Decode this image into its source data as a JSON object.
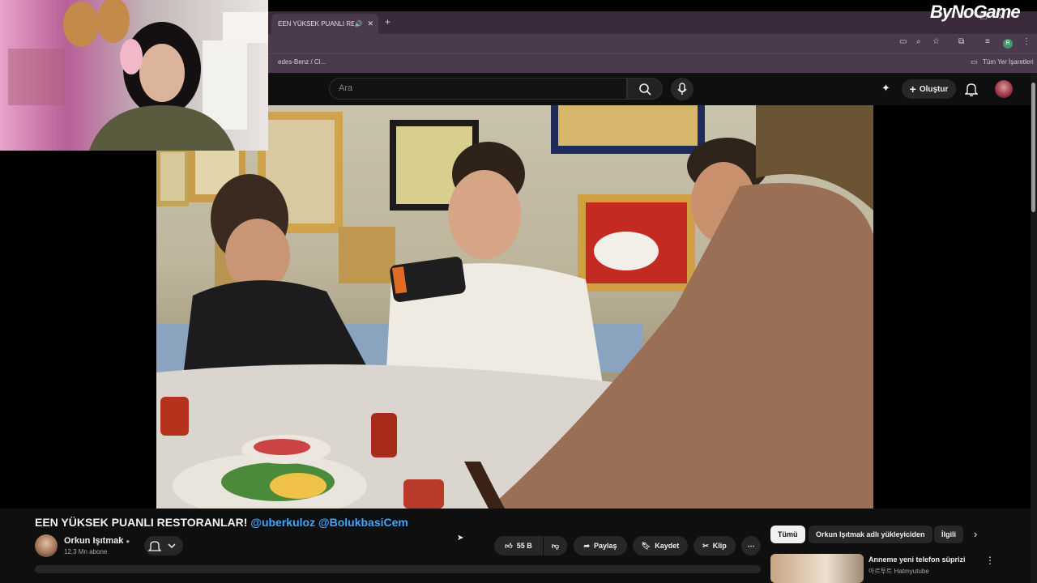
{
  "brand": {
    "logo_text": "ByNoGame"
  },
  "browser": {
    "tab_title": "EEN YÜKSEK PUANLI RESTO",
    "new_tab_symbol": "+",
    "bookmark_left": "edes-Benz / Cl...",
    "bookmark_right": "Tüm Yer İşaretleri",
    "profile_initial": "R"
  },
  "youtube": {
    "search_placeholder": "Ara",
    "create_label": "Oluştur"
  },
  "video": {
    "title_prefix": "EEN YÜKSEK PUANLI RESTORANLAR! ",
    "mention1": "@uberkuloz",
    "mention2": "@BolukbasiCem",
    "channel_name": "Orkun Işıtmak",
    "subscribers": "12,3 Mn abone",
    "likes": "55 B",
    "share_label": "Paylaş",
    "save_label": "Kaydet",
    "clip_label": "Klip"
  },
  "sidebar": {
    "chips": [
      "Tümü",
      "Orkun Işıtmak adlı yükleyiciden",
      "İlgili"
    ],
    "rec_title": "Anneme yeni telefon süprizi",
    "rec_channel": "아르투트 Hatmyutube"
  },
  "colors": {
    "mention": "#3ea6ff",
    "browser_chrome": "#4b3a4d",
    "background": "#0f0f0f"
  }
}
